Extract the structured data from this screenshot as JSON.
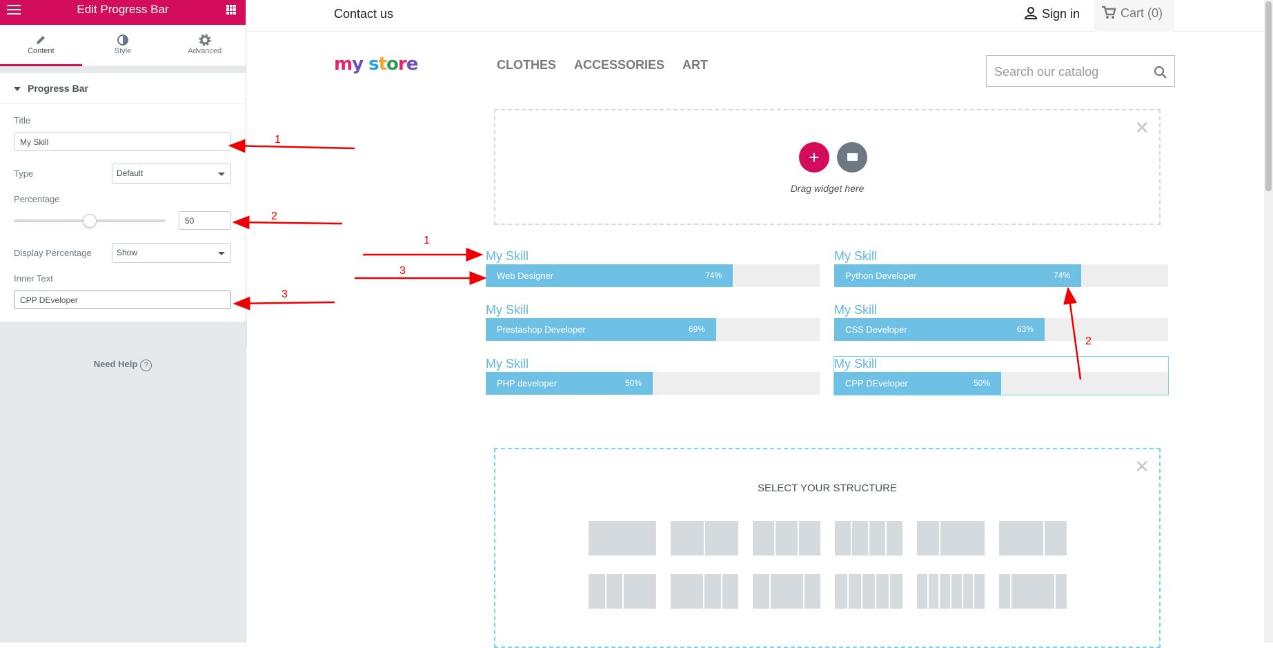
{
  "panel": {
    "title": "Edit Progress Bar",
    "tabs": [
      {
        "label": "Content",
        "icon": "pencil-icon"
      },
      {
        "label": "Style",
        "icon": "contrast-icon"
      },
      {
        "label": "Advanced",
        "icon": "gear-icon"
      }
    ],
    "active_tab": "Content",
    "section": "Progress Bar",
    "controls": {
      "title_label": "Title",
      "title_value": "My Skill",
      "type_label": "Type",
      "type_value": "Default",
      "percentage_label": "Percentage",
      "percentage_value": "50",
      "display_percentage_label": "Display Percentage",
      "display_percentage_value": "Show",
      "inner_text_label": "Inner Text",
      "inner_text_value": "CPP DEveloper"
    },
    "need_help": "Need Help",
    "accent_color": "#d30c5c"
  },
  "site": {
    "contact": "Contact us",
    "sign_in": "Sign in",
    "cart": "Cart (0)",
    "logo": "my store",
    "nav": [
      "CLOTHES",
      "ACCESSORIES",
      "ART"
    ],
    "search_placeholder": "Search our catalog",
    "dropzone_text": "Drag widget here",
    "structure_title": "SELECT YOUR STRUCTURE",
    "skills": [
      {
        "title": "My Skill",
        "inner": "Web Designer",
        "percent": "74%"
      },
      {
        "title": "My Skill",
        "inner": "Python Developer",
        "percent": "74%"
      },
      {
        "title": "My Skill",
        "inner": "Prestashop Developer",
        "percent": "69%"
      },
      {
        "title": "My Skill",
        "inner": "CSS Developer",
        "percent": "63%"
      },
      {
        "title": "My Skill",
        "inner": "PHP developer",
        "percent": "50%"
      },
      {
        "title": "My Skill",
        "inner": "CPP DEveloper",
        "percent": "50%"
      }
    ],
    "bar_color": "#6ec1e4",
    "title_color": "#61b8e0"
  },
  "annotations": {
    "labels": [
      "1",
      "2",
      "3",
      "1",
      "3",
      "2"
    ],
    "color": "#e00000"
  }
}
